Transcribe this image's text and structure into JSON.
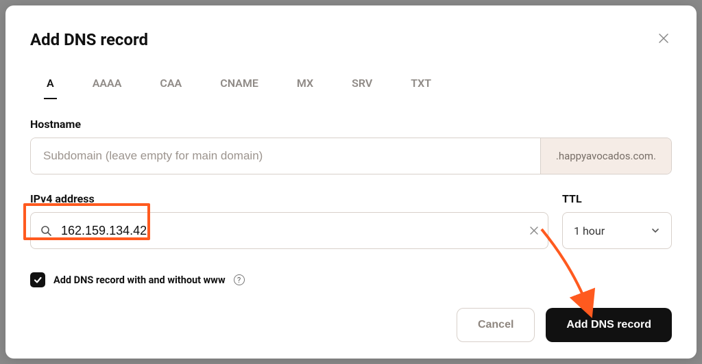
{
  "modal": {
    "title": "Add DNS record"
  },
  "tabs": [
    {
      "id": "a",
      "label": "A",
      "active": true
    },
    {
      "id": "aaaa",
      "label": "AAAA",
      "active": false
    },
    {
      "id": "caa",
      "label": "CAA",
      "active": false
    },
    {
      "id": "cname",
      "label": "CNAME",
      "active": false
    },
    {
      "id": "mx",
      "label": "MX",
      "active": false
    },
    {
      "id": "srv",
      "label": "SRV",
      "active": false
    },
    {
      "id": "txt",
      "label": "TXT",
      "active": false
    }
  ],
  "hostname": {
    "label": "Hostname",
    "placeholder": "Subdomain (leave empty for main domain)",
    "value": "",
    "domain_suffix": ".happyavocados.com."
  },
  "ipv4": {
    "label": "IPv4 address",
    "value": "162.159.134.42"
  },
  "ttl": {
    "label": "TTL",
    "selected": "1 hour"
  },
  "checkbox": {
    "checked": true,
    "label": "Add DNS record with and without www"
  },
  "buttons": {
    "cancel": "Cancel",
    "submit": "Add DNS record"
  }
}
